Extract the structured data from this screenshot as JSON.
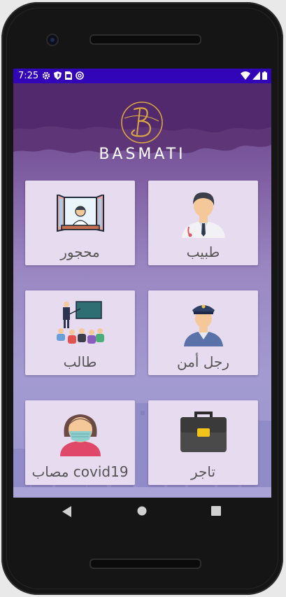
{
  "status_bar": {
    "time": "7:25",
    "icons": [
      "gear-icon",
      "shield-icon",
      "sim-card-icon",
      "at-sign-icon"
    ],
    "right_icons": [
      "wifi-icon",
      "signal-icon",
      "battery-icon"
    ],
    "background": "#3205b8"
  },
  "app": {
    "logo_letter": "B",
    "brand": "BASMATI",
    "accent_gold": "#d8a640"
  },
  "cards": [
    {
      "id": "doctor",
      "label": "طبيب",
      "icon": "doctor-icon"
    },
    {
      "id": "quarantined",
      "label": "محجور",
      "icon": "window-person-icon"
    },
    {
      "id": "security",
      "label": "رجل أمن",
      "icon": "police-officer-icon"
    },
    {
      "id": "student",
      "label": "طالب",
      "icon": "classroom-icon"
    },
    {
      "id": "merchant",
      "label": "تاجر",
      "icon": "briefcase-icon"
    },
    {
      "id": "covid",
      "label": "مصاب covid19",
      "icon": "masked-woman-icon"
    }
  ],
  "nav": {
    "back": "back-icon",
    "home": "home-icon",
    "recents": "recents-icon"
  }
}
